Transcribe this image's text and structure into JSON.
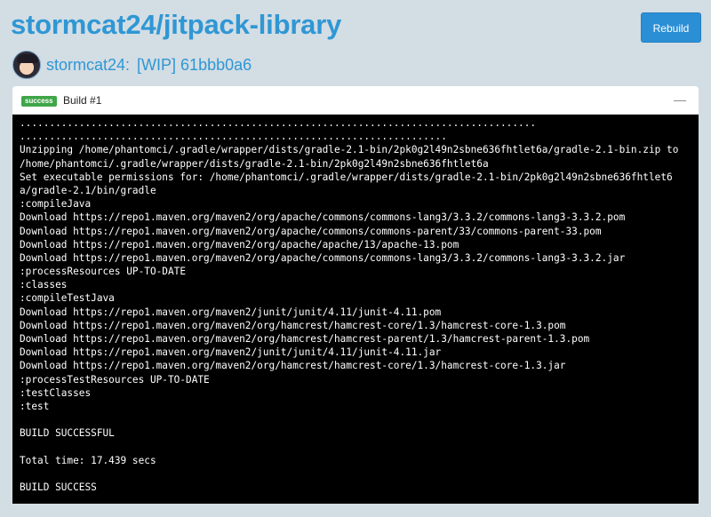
{
  "repo": {
    "title": "stormcat24/jitpack-library"
  },
  "toolbar": {
    "rebuild_label": "Rebuild"
  },
  "commit": {
    "author": "stormcat24:",
    "message": "[WIP] 61bbb0a6"
  },
  "build": {
    "status": "success",
    "label": "Build #1",
    "collapse": "—"
  },
  "log": {
    "lines": [
      ".......................................................................................",
      "........................................................................",
      "Unzipping /home/phantomci/.gradle/wrapper/dists/gradle-2.1-bin/2pk0g2l49n2sbne636fhtlet6a/gradle-2.1-bin.zip to",
      "/home/phantomci/.gradle/wrapper/dists/gradle-2.1-bin/2pk0g2l49n2sbne636fhtlet6a",
      "Set executable permissions for: /home/phantomci/.gradle/wrapper/dists/gradle-2.1-bin/2pk0g2l49n2sbne636fhtlet6",
      "a/gradle-2.1/bin/gradle",
      ":compileJava",
      "Download https://repo1.maven.org/maven2/org/apache/commons/commons-lang3/3.3.2/commons-lang3-3.3.2.pom",
      "Download https://repo1.maven.org/maven2/org/apache/commons/commons-parent/33/commons-parent-33.pom",
      "Download https://repo1.maven.org/maven2/org/apache/apache/13/apache-13.pom",
      "Download https://repo1.maven.org/maven2/org/apache/commons/commons-lang3/3.3.2/commons-lang3-3.3.2.jar",
      ":processResources UP-TO-DATE",
      ":classes",
      ":compileTestJava",
      "Download https://repo1.maven.org/maven2/junit/junit/4.11/junit-4.11.pom",
      "Download https://repo1.maven.org/maven2/org/hamcrest/hamcrest-core/1.3/hamcrest-core-1.3.pom",
      "Download https://repo1.maven.org/maven2/org/hamcrest/hamcrest-parent/1.3/hamcrest-parent-1.3.pom",
      "Download https://repo1.maven.org/maven2/junit/junit/4.11/junit-4.11.jar",
      "Download https://repo1.maven.org/maven2/org/hamcrest/hamcrest-core/1.3/hamcrest-core-1.3.jar",
      ":processTestResources UP-TO-DATE",
      ":testClasses",
      ":test",
      "",
      "BUILD SUCCESSFUL",
      "",
      "Total time: 17.439 secs",
      "",
      "BUILD SUCCESS"
    ]
  },
  "colors": {
    "accent": "#2f97d4",
    "button": "#2b8fd5",
    "success": "#3fa648",
    "background": "#d3dde4",
    "terminal": "#000000"
  }
}
